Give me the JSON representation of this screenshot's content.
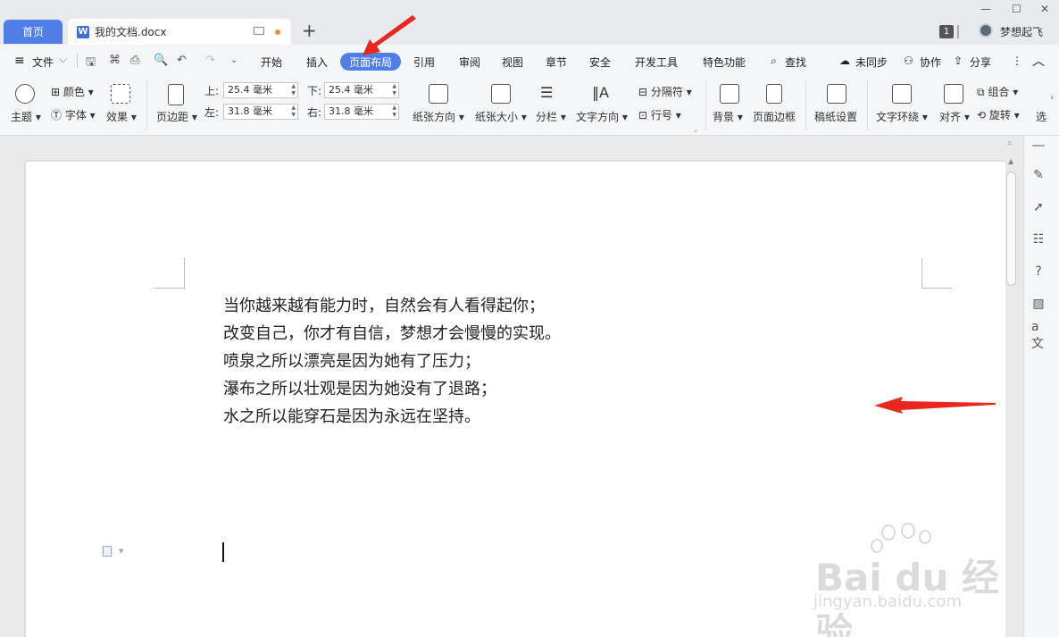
{
  "tabs": {
    "home": "首页",
    "doc_name": "我的文档.docx",
    "doc_icon_letter": "W"
  },
  "window": {
    "minimize": "—",
    "maximize": "☐",
    "close": "✕"
  },
  "user": {
    "badge": "1",
    "name": "梦想起飞"
  },
  "menu": {
    "file": "文件",
    "items": [
      "开始",
      "插入",
      "页面布局",
      "引用",
      "审阅",
      "视图",
      "章节",
      "安全",
      "开发工具",
      "特色功能"
    ],
    "active": "页面布局",
    "search": "查找",
    "sync": "未同步",
    "collab": "协作",
    "share": "分享"
  },
  "ribbon": {
    "theme": "主题",
    "color": "颜色",
    "font": "字体",
    "effect": "效果",
    "margins": "页边距",
    "top_label": "上:",
    "top_value": "25.4 毫米",
    "bottom_label": "下:",
    "bottom_value": "25.4 毫米",
    "left_label": "左:",
    "left_value": "31.8 毫米",
    "right_label": "右:",
    "right_value": "31.8 毫米",
    "orientation": "纸张方向",
    "size": "纸张大小",
    "columns": "分栏",
    "text_direction": "文字方向",
    "breaks": "分隔符",
    "line_numbers": "行号",
    "background": "背景",
    "page_border": "页面边框",
    "manuscript": "稿纸设置",
    "text_wrap": "文字环绕",
    "align": "对齐",
    "group": "组合",
    "rotate": "旋转",
    "select": "选"
  },
  "document": {
    "lines": [
      "当你越来越有能力时，自然会有人看得起你；",
      "改变自己，你才有自信，梦想才会慢慢的实现。",
      "喷泉之所以漂亮是因为她有了压力；",
      "瀑布之所以壮观是因为她没有了退路；",
      "水之所以能穿石是因为永远在坚持。"
    ]
  },
  "watermark": {
    "logo": "Bai du 经验",
    "url": "jingyan.baidu.com"
  },
  "colors": {
    "accent": "#4f7ee6",
    "arrow": "#e8281e",
    "tab_dot": "#f08a3c"
  }
}
